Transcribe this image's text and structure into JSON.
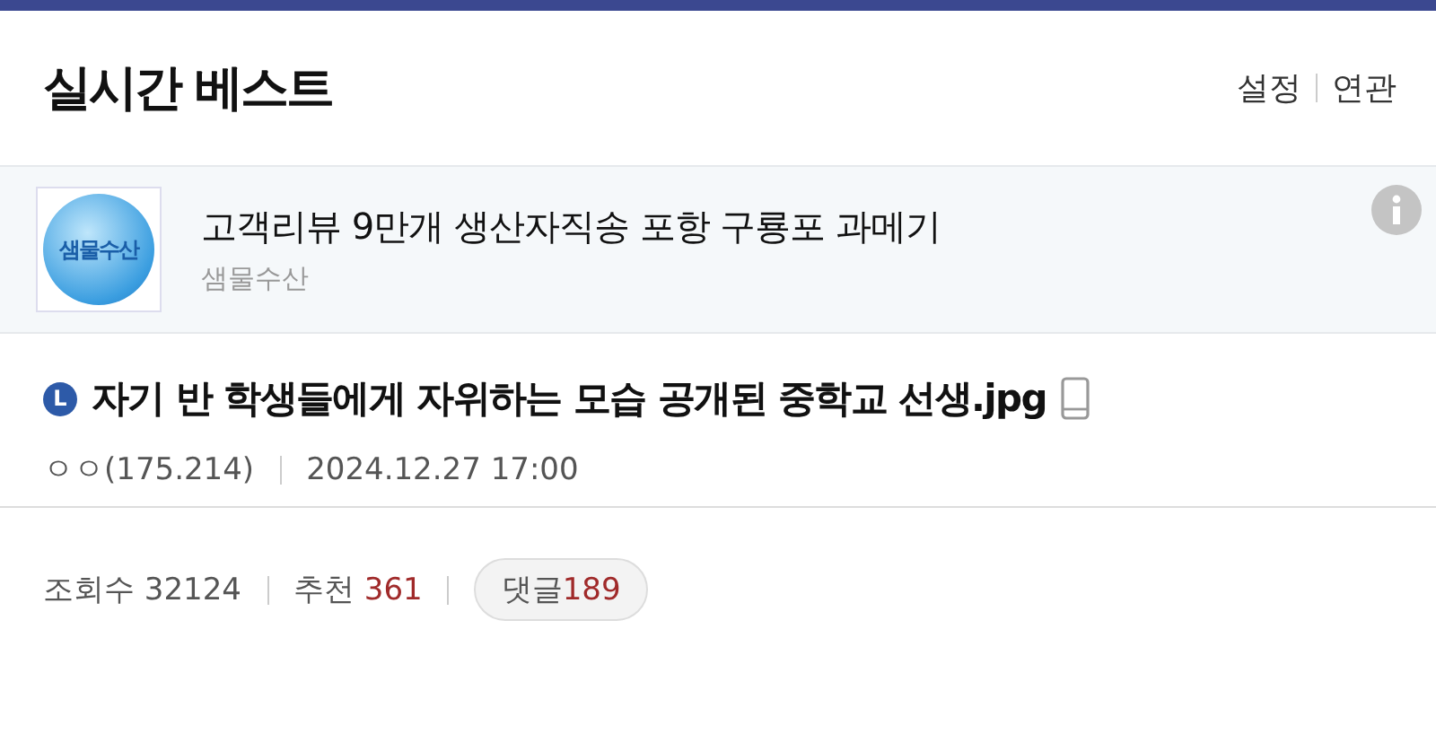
{
  "header": {
    "title": "실시간 베스트",
    "links": [
      "설정",
      "연관"
    ]
  },
  "ad": {
    "logo_text": "샘물수산",
    "title": "고객리뷰 9만개 생산자직송 포항 구룡포 과메기",
    "advertiser": "샘물수산"
  },
  "post": {
    "badge": "L",
    "title": "자기 반 학생들에게 자위하는 모습 공개된 중학교 선생.jpg",
    "mobile": true,
    "author": "ㅇㅇ(175.214)",
    "date": "2024.12.27 17:00"
  },
  "stats": {
    "views_label": "조회수",
    "views": "32124",
    "recommend_label": "추천",
    "recommend": "361",
    "comments_label": "댓글",
    "comments": "189"
  }
}
